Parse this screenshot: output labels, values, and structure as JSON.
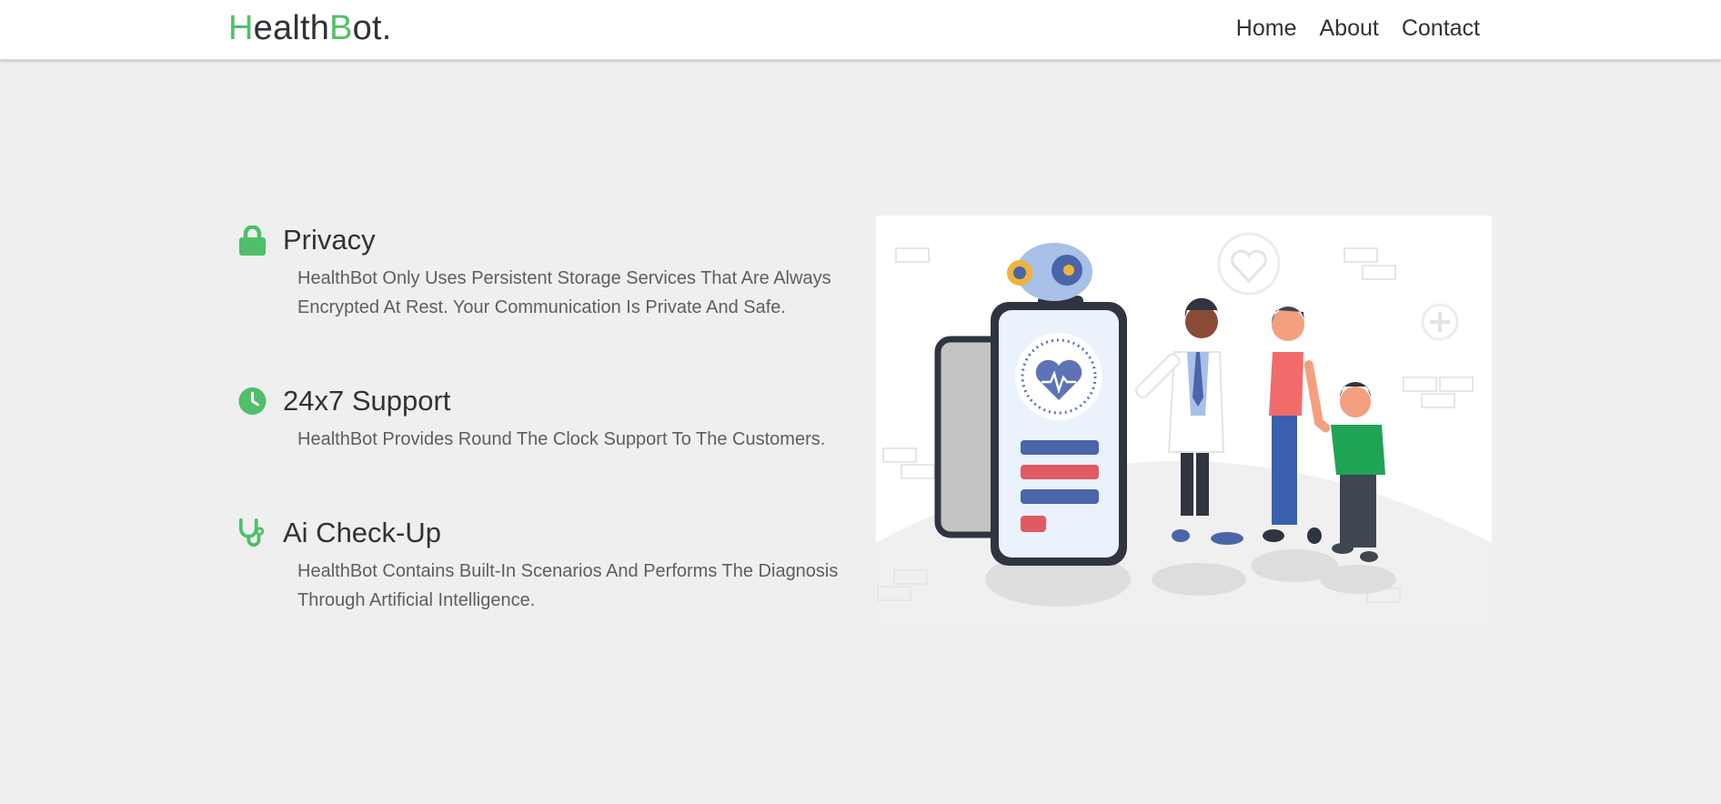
{
  "brand": {
    "logo_parts": [
      "H",
      "ealth",
      "B",
      "ot."
    ],
    "accent_color": "#4fbf6a",
    "text_color": "#2f3237"
  },
  "nav": {
    "links": [
      "Home",
      "About",
      "Contact"
    ]
  },
  "features": [
    {
      "icon": "lock-icon",
      "title": "Privacy",
      "description": "HealthBot Only Uses Persistent Storage Services That Are Always Encrypted At Rest. Your Communication Is Private And Safe."
    },
    {
      "icon": "clock-icon",
      "title": "24x7 Support",
      "description": "HealthBot Provides Round The Clock Support To The Customers."
    },
    {
      "icon": "stethoscope-icon",
      "title": "Ai Check-Up",
      "description": "HealthBot Contains Built-In Scenarios And Performs The Diagnosis Through Artificial Intelligence."
    }
  ],
  "colors": {
    "page_background": "#efefef",
    "navbar_background": "#ffffff",
    "description_text": "#5b5e63"
  }
}
